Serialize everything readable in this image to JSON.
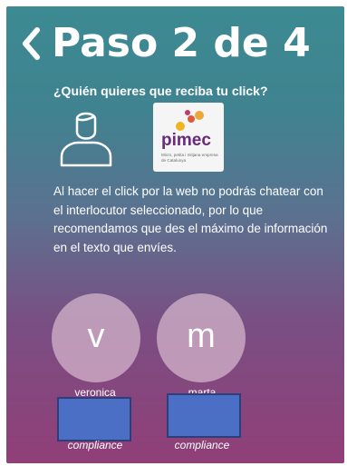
{
  "header": {
    "title": "Paso 2 de 4"
  },
  "question": "¿Quién quieres que reciba tu click?",
  "recipients": {
    "person_icon": "user-icon",
    "org_logo": {
      "name": "pimec",
      "subtitle": "Micro, petita i mitjana empresa de Catalunya"
    }
  },
  "info_text": "Al hacer el click por la web no podrás chatear con el interlocutor seleccionado, por lo que recomendamos que des el máximo de información en el texto que envíes.",
  "contacts": [
    {
      "initial": "v",
      "name": "veronica",
      "department": "compliance"
    },
    {
      "initial": "m",
      "name": "marta",
      "department": "compliance"
    }
  ],
  "colors": {
    "gradient_top": "#3c8a92",
    "gradient_bottom": "#913f77",
    "avatar_fill": "#d7b9cd",
    "overlay_box": "#4a6fc4",
    "pimec_purple": "#6a2a7a"
  }
}
